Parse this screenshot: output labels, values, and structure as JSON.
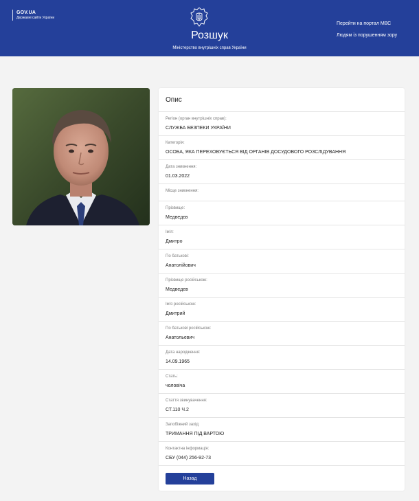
{
  "header": {
    "gov_title": "GOV.UA",
    "gov_subtitle": "Державні сайти України",
    "site_title": "Розшук",
    "site_subtitle": "Міністерство внутрішніх справ України",
    "links": [
      "Перейти на портал МВС",
      "Людям із порушенням зору"
    ],
    "emblem_icon": "trident-shield-emblem"
  },
  "colors": {
    "brand_blue": "#24409a",
    "page_background": "#f3f3f3",
    "card_background": "#ffffff"
  },
  "card": {
    "title": "Опис",
    "fields": [
      {
        "label": "Регіон (орган внутрішніх справ):",
        "value": "СЛУЖБА БЕЗПЕКИ УКРАЇНИ"
      },
      {
        "label": "Категорія:",
        "value": "ОСОБА, ЯКА ПЕРЕХОВУЄТЬСЯ ВІД ОРГАНІВ ДОСУДОВОГО РОЗСЛІДУВАННЯ"
      },
      {
        "label": "Дата зникнення:",
        "value": "01.03.2022"
      },
      {
        "label": "Місце зникнення:",
        "value": ""
      },
      {
        "label": "Прізвище:",
        "value": "Медведєв"
      },
      {
        "label": "Ім'я:",
        "value": "Дмитро"
      },
      {
        "label": "По батькові:",
        "value": "Анатолійович"
      },
      {
        "label": "Прізвище російською:",
        "value": "Медведев"
      },
      {
        "label": "Ім'я російською:",
        "value": "Дмитрий"
      },
      {
        "label": "По батькові російською:",
        "value": "Анатольевич"
      },
      {
        "label": "Дата народження:",
        "value": "14.09.1965"
      },
      {
        "label": "Стать:",
        "value": "чоловіча"
      },
      {
        "label": "Стаття звинувачення:",
        "value": "СТ.110 Ч.2"
      },
      {
        "label": "Запобіжний захід:",
        "value": "ТРИМАННЯ ПІД ВАРТОЮ"
      },
      {
        "label": "Контактна інформація:",
        "value": "СБУ (044) 256-92-73"
      }
    ],
    "back_button": "Назад"
  }
}
